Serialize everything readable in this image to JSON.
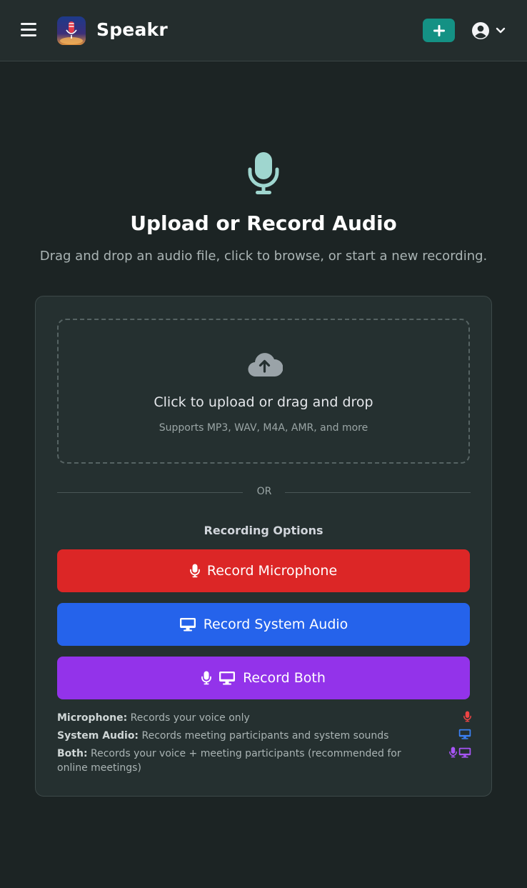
{
  "header": {
    "brand": "Speakr",
    "menu_icon": "hamburger-menu-icon",
    "new_icon": "plus-icon",
    "user_icon": "user-circle-icon",
    "caret_icon": "chevron-down-icon"
  },
  "hero": {
    "icon": "microphone-icon",
    "title": "Upload or Record Audio",
    "subtitle": "Drag and drop an audio file, click to browse, or start a new recording."
  },
  "dropzone": {
    "icon": "cloud-upload-icon",
    "title": "Click to upload or drag and drop",
    "subtitle": "Supports MP3, WAV, M4A, AMR, and more"
  },
  "divider": {
    "label": "OR"
  },
  "recording": {
    "title": "Recording Options",
    "buttons": [
      {
        "label": "Record Microphone",
        "color": "#dc2626",
        "icons": [
          "microphone-icon"
        ]
      },
      {
        "label": "Record System Audio",
        "color": "#2563eb",
        "icons": [
          "desktop-icon"
        ]
      },
      {
        "label": "Record Both",
        "color": "#9333ea",
        "icons": [
          "microphone-icon",
          "desktop-icon"
        ]
      }
    ],
    "legend": [
      {
        "term": "Microphone:",
        "desc": "Records your voice only",
        "color": "#ef4444"
      },
      {
        "term": "System Audio:",
        "desc": "Records meeting participants and system sounds",
        "color": "#3b82f6"
      },
      {
        "term": "Both:",
        "desc": "Records your voice + meeting participants (recommended for online meetings)",
        "color": "#a855f7"
      }
    ]
  },
  "colors": {
    "accent": "#149184",
    "background": "#1c2424",
    "card": "#253030"
  }
}
